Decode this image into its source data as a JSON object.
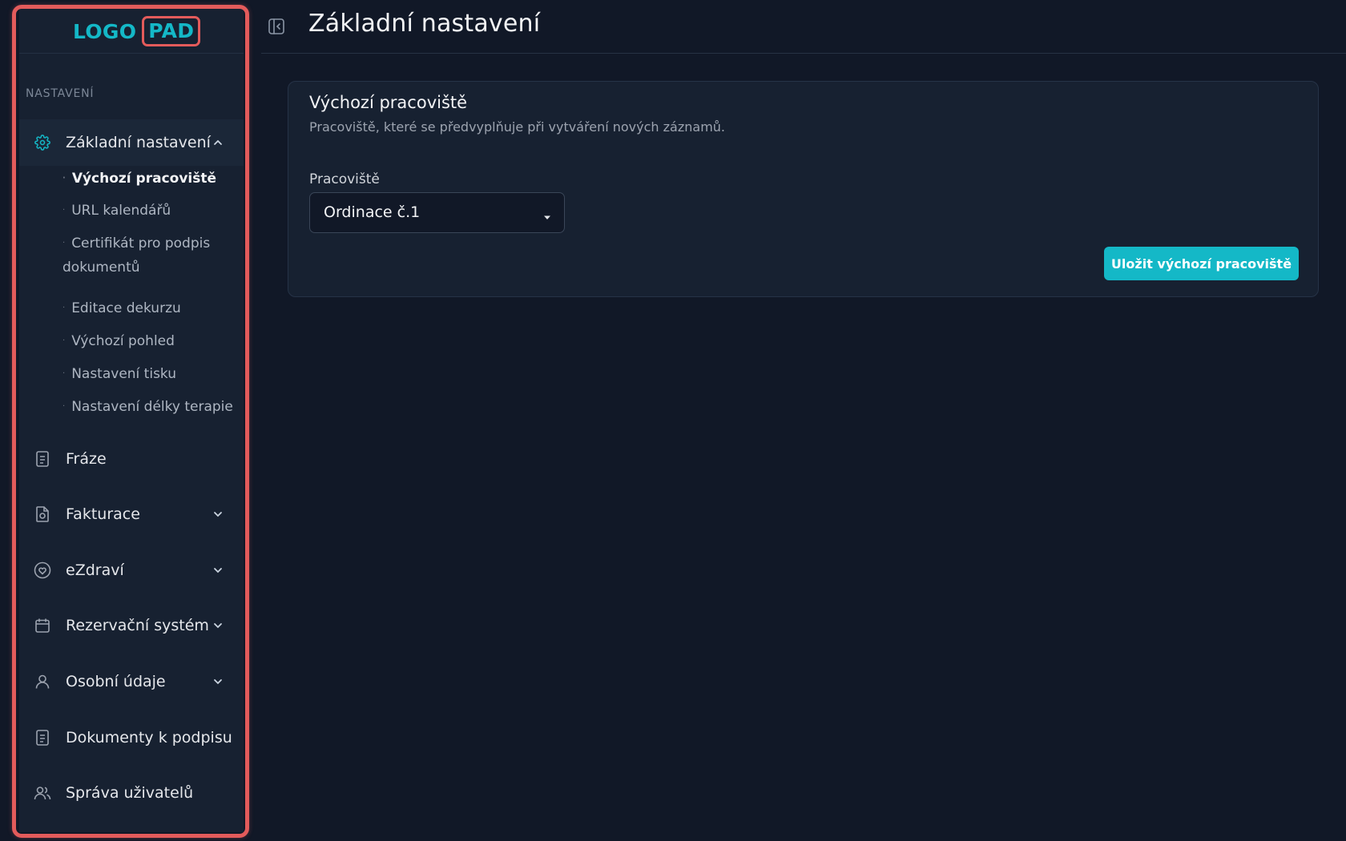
{
  "logo": {
    "part1": "LOGO",
    "part2": "PAD"
  },
  "sidebar": {
    "section_title": "NASTAVENÍ",
    "active_item": {
      "label": "Základní nastavení",
      "icon": "gear-icon"
    },
    "sub_items": [
      {
        "label": "Výchozí pracoviště",
        "current": true
      },
      {
        "label": "URL kalendářů"
      },
      {
        "label": "Certifikát pro podpis dokumentů"
      },
      {
        "label": "Editace dekurzu"
      },
      {
        "label": "Výchozí pohled"
      },
      {
        "label": "Nastavení tisku"
      },
      {
        "label": "Nastavení délky terapie"
      }
    ],
    "items": [
      {
        "label": "Fráze",
        "icon": "document-icon"
      },
      {
        "label": "Fakturace",
        "icon": "invoice-icon"
      },
      {
        "label": "eZdraví",
        "icon": "heart-icon"
      },
      {
        "label": "Rezervační systém",
        "icon": "calendar-icon"
      },
      {
        "label": "Osobní údaje",
        "icon": "user-icon"
      },
      {
        "label": "Dokumenty k podpisu",
        "icon": "document-icon"
      },
      {
        "label": "Správa uživatelů",
        "icon": "users-icon"
      }
    ]
  },
  "header": {
    "title": "Základní nastavení"
  },
  "card": {
    "title": "Výchozí pracoviště",
    "description": "Pracoviště, které se předvyplňuje při vytváření nových záznamů.",
    "field_label": "Pracoviště",
    "select_value": "Ordinace č.1",
    "save_label": "Uložit výchozí pracoviště"
  },
  "colors": {
    "accent": "#14b8c7",
    "highlight": "#e35b5b",
    "background": "#111827",
    "panel": "#172131"
  }
}
